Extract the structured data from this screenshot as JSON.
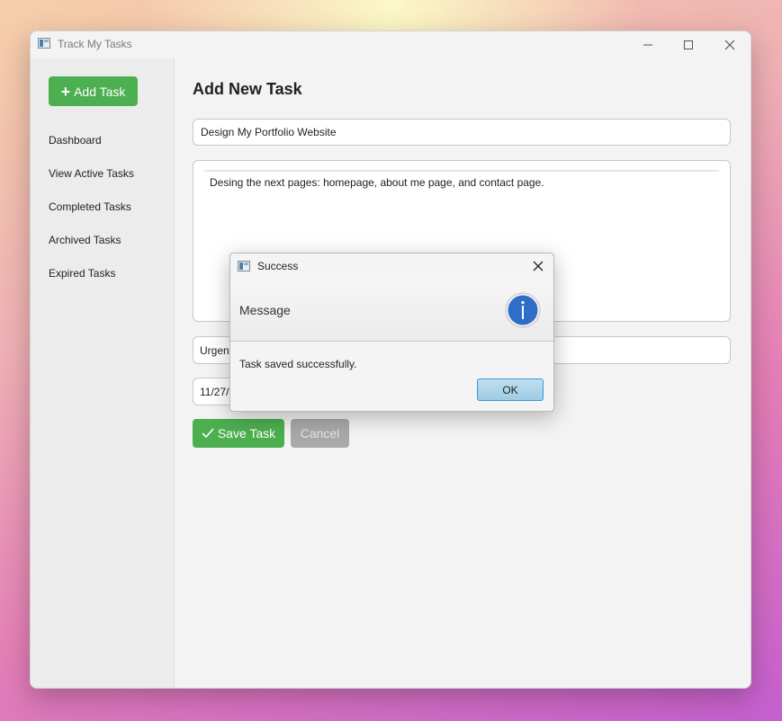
{
  "window": {
    "title": "Track My Tasks"
  },
  "sidebar": {
    "add_button_label": "Add Task",
    "items": [
      {
        "label": "Dashboard"
      },
      {
        "label": "View Active Tasks"
      },
      {
        "label": "Completed Tasks"
      },
      {
        "label": "Archived Tasks"
      },
      {
        "label": "Expired Tasks"
      }
    ]
  },
  "form": {
    "heading": "Add New Task",
    "title_value": "Design My Portfolio Website",
    "description_value": "Desing the next pages: homepage, about me page, and contact page.",
    "priority_value": "Urgent",
    "date_value": "11/27/",
    "save_label": "Save Task",
    "cancel_label": "Cancel"
  },
  "dialog": {
    "title": "Success",
    "header": "Message",
    "content": "Task saved successfully.",
    "ok_label": "OK",
    "icon": "info-icon"
  },
  "colors": {
    "accent_green": "#4caf50",
    "disabled_gray": "#a9a9a9",
    "info_blue": "#2f6ec8",
    "ok_border": "#3b9bd6"
  }
}
